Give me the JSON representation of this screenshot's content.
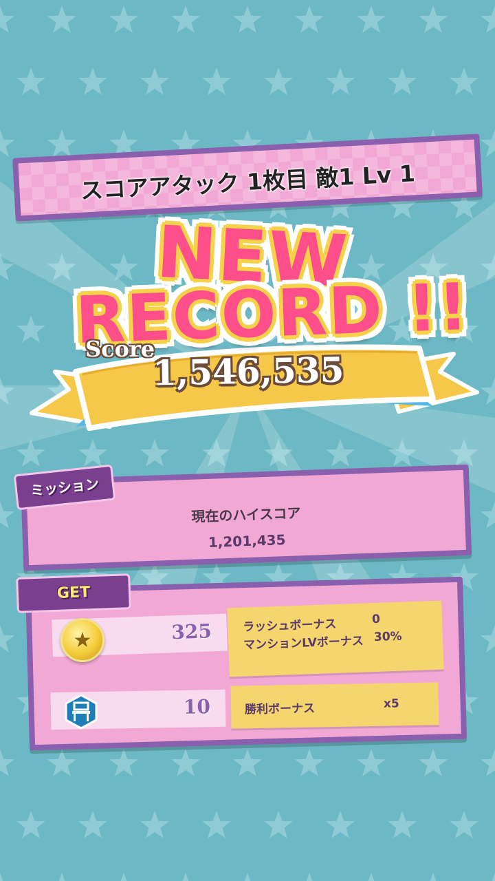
{
  "title": "スコアアタック 1枚目 敵1 Lv 1",
  "record": {
    "line1": "NEW",
    "line2": "RECORD !!"
  },
  "score": {
    "label": "Score",
    "value": "1,546,535"
  },
  "mission": {
    "tag": "ミッション",
    "title": "現在のハイスコア",
    "value": "1,201,435"
  },
  "get": {
    "tag": "GET",
    "coin_count": "325",
    "chair_count": "10",
    "rush_bonus_label": "ラッシュボーナス",
    "rush_bonus_value": "0",
    "mansion_bonus_label": "マンションLVボーナス",
    "mansion_bonus_value": "30%",
    "win_bonus_label": "勝利ボーナス",
    "win_bonus_value": "x5"
  },
  "colors": {
    "background": "#6cb8c4",
    "panel_border": "#8a5fae",
    "panel_fill": "#f2a8d4",
    "accent_pink": "#ff4f8a",
    "ribbon_yellow": "#f5c84a"
  },
  "icons": {
    "coin": "star-coin-icon",
    "chair": "chair-badge-icon"
  }
}
